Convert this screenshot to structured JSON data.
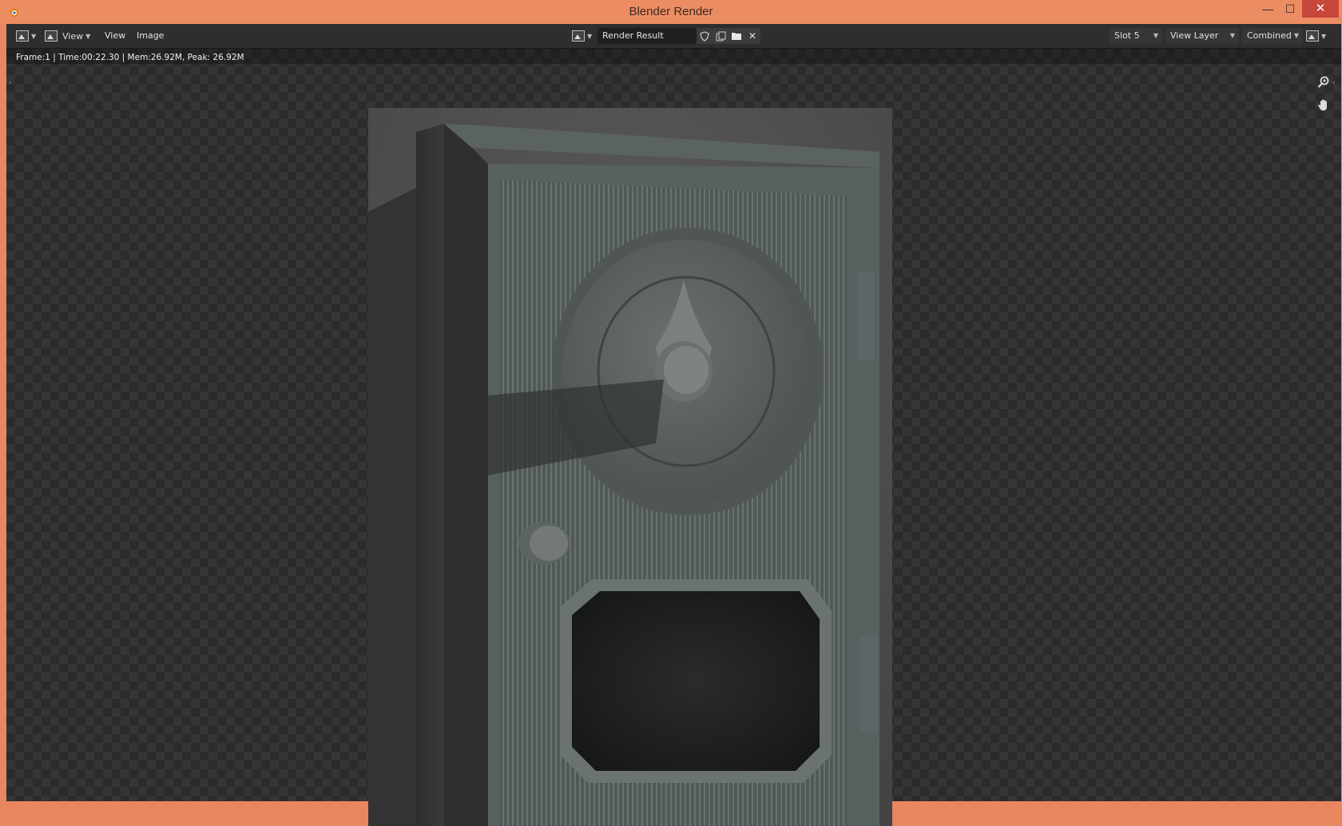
{
  "window": {
    "title": "Blender Render",
    "minimize_glyph": "—",
    "maximize_glyph": "☐",
    "close_glyph": "✕"
  },
  "header": {
    "view_dropdown_label": "View",
    "menu_view": "View",
    "menu_image": "Image",
    "image_name": "Render Result",
    "slot": "Slot 5",
    "view_layer": "View Layer",
    "pass": "Combined"
  },
  "status": {
    "text": "Frame:1 | Time:00:22.30 | Mem:26.92M, Peak: 26.92M"
  },
  "colors": {
    "titlebar": "#ec8c62",
    "close_button": "#c7463a",
    "header_bg": "#2e2e2e",
    "viewport_bg": "#2b2b2b"
  },
  "icons": [
    "blender-logo-icon",
    "editor-type-icon",
    "image-icon",
    "shield-icon",
    "duplicate-icon",
    "folder-icon",
    "close-icon",
    "zoom-icon",
    "hand-pan-icon",
    "display-mode-icon"
  ]
}
